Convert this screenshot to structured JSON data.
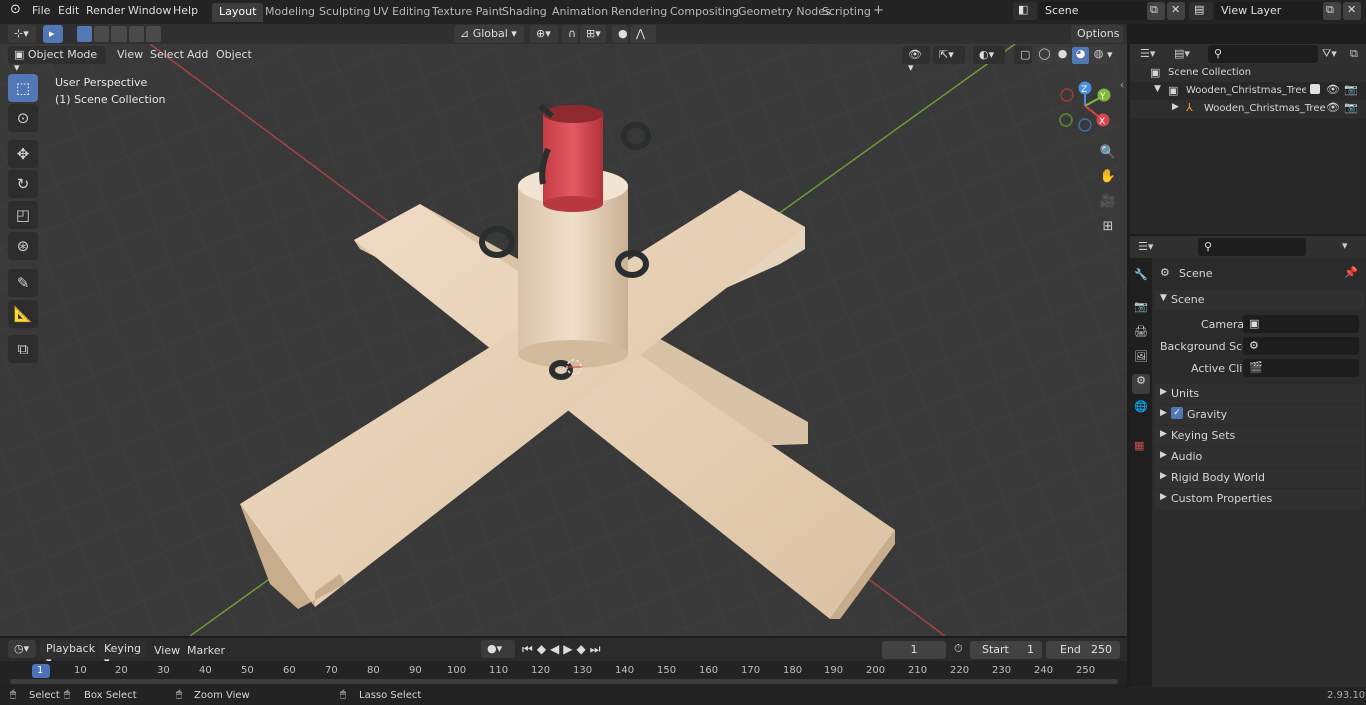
{
  "menu": {
    "file": "File",
    "edit": "Edit",
    "render": "Render",
    "window": "Window",
    "help": "Help"
  },
  "workspaces": [
    "Layout",
    "Modeling",
    "Sculpting",
    "UV Editing",
    "Texture Paint",
    "Shading",
    "Animation",
    "Rendering",
    "Compositing",
    "Geometry Nodes",
    "Scripting"
  ],
  "scene_field": "Scene",
  "view_layer_field": "View Layer",
  "viewport": {
    "mode": "Object Mode",
    "view": "View",
    "select": "Select",
    "add": "Add",
    "object": "Object",
    "transform_orientation": "Global",
    "options": "Options",
    "overlay_title": "User Perspective",
    "overlay_collection": "(1) Scene Collection"
  },
  "outliner": {
    "root": "Scene Collection",
    "items": [
      {
        "label": "Wooden_Christmas_Tree_Sta"
      },
      {
        "label": "Wooden_Christmas_Tree"
      }
    ]
  },
  "properties": {
    "header": "Scene",
    "section": "Scene",
    "camera_label": "Camera",
    "bg_scene_label": "Background Scene",
    "active_clip_label": "Active Clip",
    "panels": [
      "Units",
      "Gravity",
      "Keying Sets",
      "Audio",
      "Rigid Body World",
      "Custom Properties"
    ]
  },
  "timeline": {
    "playback": "Playback",
    "keying": "Keying",
    "view": "View",
    "marker": "Marker",
    "current_frame": "1",
    "start_label": "Start",
    "start_value": "1",
    "end_label": "End",
    "end_value": "250",
    "ticks": [
      "1",
      "10",
      "20",
      "30",
      "40",
      "50",
      "60",
      "70",
      "80",
      "90",
      "100",
      "110",
      "120",
      "130",
      "140",
      "150",
      "160",
      "170",
      "180",
      "190",
      "200",
      "210",
      "220",
      "230",
      "240",
      "250"
    ]
  },
  "statusbar": {
    "select": "Select",
    "box_select": "Box Select",
    "zoom_view": "Zoom View",
    "lasso_select": "Lasso Select",
    "version": "2.93.10"
  },
  "colors": {
    "accent": "#5177b4",
    "active_tab": "#3d3d3d",
    "x_axis": "#d8464a",
    "y_axis": "#7fb83a",
    "z_axis": "#4a8fe0"
  }
}
